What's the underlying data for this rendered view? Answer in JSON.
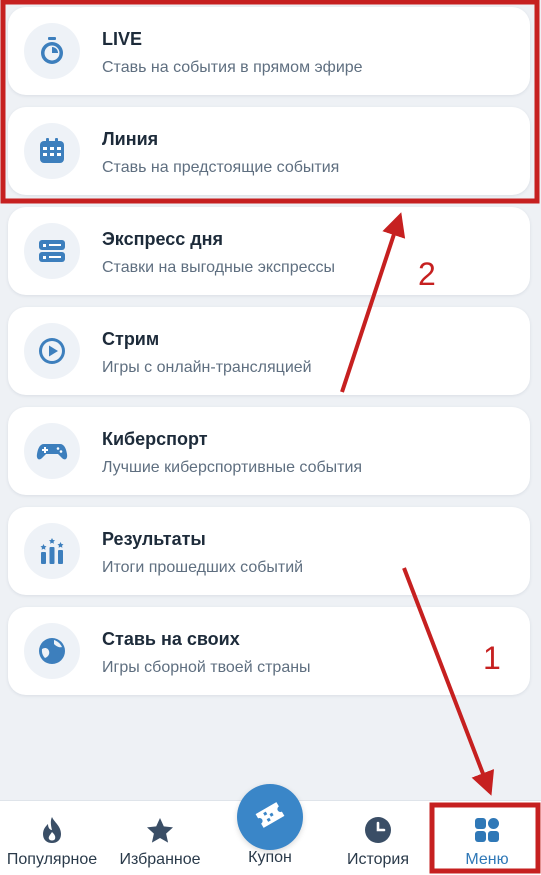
{
  "menu": {
    "items": [
      {
        "title": "LIVE",
        "subtitle": "Ставь на события в прямом эфире",
        "icon": "stopwatch-icon"
      },
      {
        "title": "Линия",
        "subtitle": "Ставь на предстоящие события",
        "icon": "calendar-icon"
      },
      {
        "title": "Экспресс дня",
        "subtitle": "Ставки на выгодные экспрессы",
        "icon": "express-icon"
      },
      {
        "title": "Стрим",
        "subtitle": "Игры с онлайн-трансляцией",
        "icon": "play-icon"
      },
      {
        "title": "Киберспорт",
        "subtitle": "Лучшие киберспортивные события",
        "icon": "gamepad-icon"
      },
      {
        "title": "Результаты",
        "subtitle": "Итоги прошедших событий",
        "icon": "results-icon"
      },
      {
        "title": "Ставь на своих",
        "subtitle": "Игры сборной твоей страны",
        "icon": "globe-icon"
      }
    ]
  },
  "tabbar": {
    "tabs": [
      {
        "label": "Популярное",
        "icon": "flame-icon"
      },
      {
        "label": "Избранное",
        "icon": "star-icon"
      },
      {
        "label": "Купон",
        "icon": "ticket-icon"
      },
      {
        "label": "История",
        "icon": "clock-icon"
      },
      {
        "label": "Меню",
        "icon": "grid-icon"
      }
    ],
    "active": "Меню"
  },
  "annotations": {
    "step1": "1",
    "step2": "2"
  },
  "colors": {
    "accent": "#3a86c8",
    "icon": "#3d7fbd",
    "annotation": "#c62020",
    "background": "#eef1f5"
  }
}
